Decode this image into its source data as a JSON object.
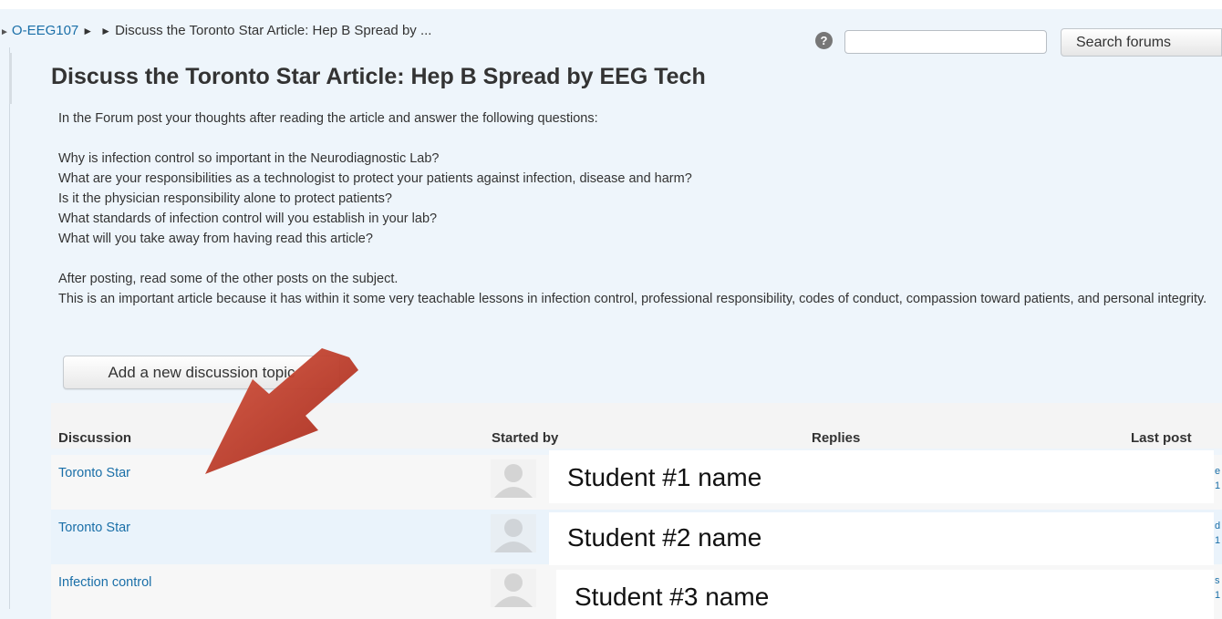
{
  "breadcrumb": {
    "course": "O-EEG107",
    "separator": "►",
    "current": "Discuss the Toronto Star Article: Hep B Spread by ..."
  },
  "help": {
    "icon": "question-circle-icon",
    "glyph": "?"
  },
  "search": {
    "value": "",
    "placeholder": "",
    "button_label": "Search forums"
  },
  "page_title": "Discuss the Toronto Star Article: Hep B Spread by EEG Tech",
  "intro": {
    "lead": "In the Forum post your thoughts after reading the article and answer the following questions:",
    "questions": [
      "Why is infection control so important in the Neurodiagnostic Lab?",
      "What are your responsibilities as a technologist to protect your patients against infection, disease and harm?",
      "Is it the physician responsibility alone to protect patients?",
      "What standards of infection control will you establish in your lab?",
      "What will you take away from having read this article?"
    ],
    "closing": [
      "After posting, read some of the other posts on the subject.",
      "This is an important article because it has within it some very teachable lessons in infection control, professional responsibility, codes of conduct, compassion toward patients, and personal integrity."
    ]
  },
  "add_topic_label": "Add a new discussion topic",
  "table": {
    "headers": {
      "discussion": "Discussion",
      "started_by": "Started by",
      "replies": "Replies",
      "last_post": "Last post"
    },
    "rows": [
      {
        "topic": "Toronto Star",
        "started_by": "Student #1  name",
        "last_post_fragment": [
          "e",
          "1"
        ]
      },
      {
        "topic": "Toronto Star",
        "started_by": "Student #2  name",
        "last_post_fragment": [
          "d",
          "1"
        ]
      },
      {
        "topic": "Infection control",
        "started_by": "Student #3 name",
        "last_post_fragment": [
          "s",
          "1"
        ]
      }
    ]
  },
  "colors": {
    "link": "#1a6fa8",
    "page_background": "#eef5fb",
    "annotation_arrow": "#c0392b"
  },
  "icons": {
    "avatar": "default-user-avatar-icon",
    "annotation": "red-pointer-arrow-icon"
  }
}
